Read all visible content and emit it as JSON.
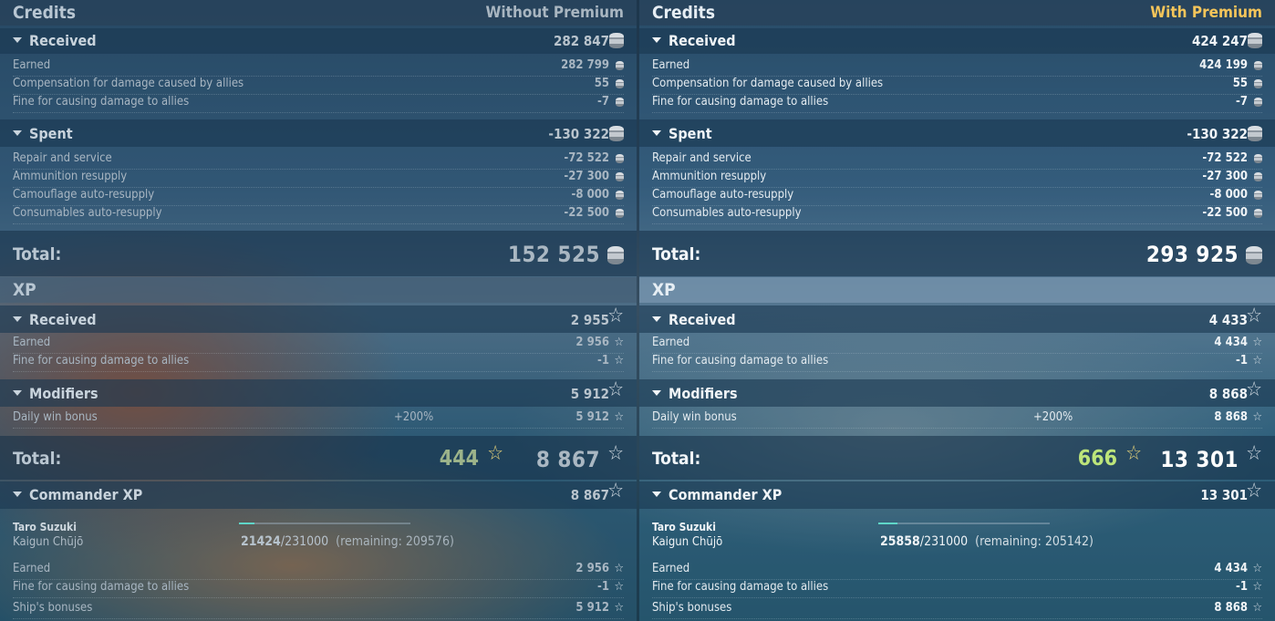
{
  "left": {
    "credits_title": "Credits",
    "mode": "Without Premium",
    "received": {
      "label": "Received",
      "value": "282 847",
      "rows": [
        {
          "label": "Earned",
          "value": "282 799"
        },
        {
          "label": "Compensation for damage caused by allies",
          "value": "55"
        },
        {
          "label": "Fine for causing damage to allies",
          "value": "-7"
        }
      ]
    },
    "spent": {
      "label": "Spent",
      "value": "-130 322",
      "rows": [
        {
          "label": "Repair and service",
          "value": "-72 522"
        },
        {
          "label": "Ammunition resupply",
          "value": "-27 300"
        },
        {
          "label": "Camouflage auto-resupply",
          "value": "-8 000"
        },
        {
          "label": "Consumables auto-resupply",
          "value": "-22 500"
        }
      ]
    },
    "credits_total_label": "Total:",
    "credits_total": "152 525",
    "xp_title": "XP",
    "xp_received": {
      "label": "Received",
      "value": "2 955",
      "rows": [
        {
          "label": "Earned",
          "value": "2 956"
        },
        {
          "label": "Fine for causing damage to allies",
          "value": "-1"
        }
      ]
    },
    "modifiers": {
      "label": "Modifiers",
      "value": "5 912",
      "rows": [
        {
          "label": "Daily win bonus",
          "modifier": "+200%",
          "value": "5 912"
        }
      ]
    },
    "xp_total_label": "Total:",
    "free_xp": "444",
    "xp_total": "8 867",
    "commander": {
      "label": "Commander XP",
      "value": "8 867",
      "name": "Taro Suzuki",
      "rank": "Kaigun Chūjō",
      "progress_current": "21424",
      "progress_max": "/231000",
      "remaining": "(remaining: 209576)",
      "progress_fraction": 0.0927,
      "rows": [
        {
          "label": "Earned",
          "value": "2 956"
        },
        {
          "label": "Fine for causing damage to allies",
          "value": "-1"
        },
        {
          "label": "Ship's bonuses",
          "value": "5 912"
        }
      ]
    }
  },
  "right": {
    "credits_title": "Credits",
    "mode": "With Premium",
    "received": {
      "label": "Received",
      "value": "424 247",
      "rows": [
        {
          "label": "Earned",
          "value": "424 199"
        },
        {
          "label": "Compensation for damage caused by allies",
          "value": "55"
        },
        {
          "label": "Fine for causing damage to allies",
          "value": "-7"
        }
      ]
    },
    "spent": {
      "label": "Spent",
      "value": "-130 322",
      "rows": [
        {
          "label": "Repair and service",
          "value": "-72 522"
        },
        {
          "label": "Ammunition resupply",
          "value": "-27 300"
        },
        {
          "label": "Camouflage auto-resupply",
          "value": "-8 000"
        },
        {
          "label": "Consumables auto-resupply",
          "value": "-22 500"
        }
      ]
    },
    "credits_total_label": "Total:",
    "credits_total": "293 925",
    "xp_title": "XP",
    "xp_received": {
      "label": "Received",
      "value": "4 433",
      "rows": [
        {
          "label": "Earned",
          "value": "4 434"
        },
        {
          "label": "Fine for causing damage to allies",
          "value": "-1"
        }
      ]
    },
    "modifiers": {
      "label": "Modifiers",
      "value": "8 868",
      "rows": [
        {
          "label": "Daily win bonus",
          "modifier": "+200%",
          "value": "8 868"
        }
      ]
    },
    "xp_total_label": "Total:",
    "free_xp": "666",
    "xp_total": "13 301",
    "commander": {
      "label": "Commander XP",
      "value": "13 301",
      "name": "Taro Suzuki",
      "rank": "Kaigun Chūjō",
      "progress_current": "25858",
      "progress_max": "/231000",
      "remaining": "(remaining: 205142)",
      "progress_fraction": 0.1119,
      "rows": [
        {
          "label": "Earned",
          "value": "4 434"
        },
        {
          "label": "Fine for causing damage to allies",
          "value": "-1"
        },
        {
          "label": "Ship's bonuses",
          "value": "8 868"
        }
      ]
    }
  },
  "icons": {
    "credits": "credits-coin-icon",
    "xp": "star-icon",
    "collapse": "collapse-arrow-icon"
  },
  "colors": {
    "premium": "#f4c55a",
    "free_xp_premium": "#bde57a",
    "progress": "#5fd6c8"
  }
}
